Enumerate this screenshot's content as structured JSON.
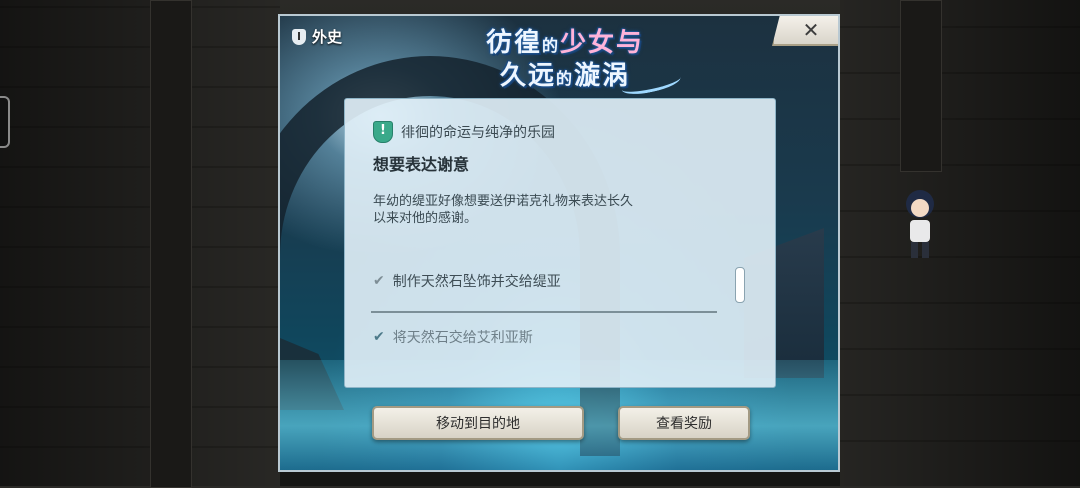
{
  "header": {
    "side_story_label": "外史",
    "logo_line1": "彷徨",
    "logo_line1_small": "的",
    "logo_line1_b": "少女与",
    "logo_line2": "久远",
    "logo_line2_small": "的",
    "logo_line2_b": "漩涡",
    "close_label": "✕"
  },
  "quest": {
    "chapter": "徘徊的命运与纯净的乐园",
    "title": "想要表达谢意",
    "description": "年幼的缇亚好像想要送伊诺克礼物来表达长久以来对他的感谢。",
    "objectives": [
      {
        "label": "制作天然石坠饰并交给缇亚",
        "check": "✔"
      },
      {
        "label": "将天然石交给艾利亚斯",
        "check": "✔"
      }
    ]
  },
  "buttons": {
    "move": "移动到目的地",
    "reward": "查看奖励"
  },
  "colors": {
    "accent": "#3aa98a",
    "panel_border": "#b9c9d2",
    "card_bg": "#deeef6"
  }
}
